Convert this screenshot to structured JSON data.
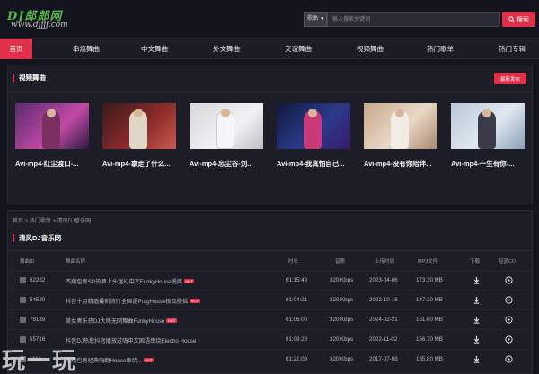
{
  "header": {
    "logo_title": "DJ郎郎网",
    "logo_sub": "www.djjjj.com",
    "search_type": "歌曲",
    "search_placeholder": "输入搜索关键词",
    "search_button": "搜索"
  },
  "nav": {
    "items": [
      "首页",
      "串烧舞曲",
      "中文舞曲",
      "外文舞曲",
      "交谊舞曲",
      "视频舞曲",
      "热门歌单",
      "热门专辑"
    ],
    "active_index": 0
  },
  "video_section": {
    "title": "视频舞曲",
    "latest_button": "最新发布",
    "videos": [
      {
        "label": "Avi-mp4-红尘渡口-..."
      },
      {
        "label": "Avi-mp4-拿走了什么..."
      },
      {
        "label": "Avi-mp4-忘尘谷-刘..."
      },
      {
        "label": "Avi-mp4-我真怕自己..."
      },
      {
        "label": "Avi-mp4-没有你陪伴..."
      },
      {
        "label": "Avi-mp4-一生有你-..."
      }
    ]
  },
  "list_section": {
    "breadcrumb": "首页 > 热门歌单 > 清风DJ音乐网",
    "title": "清风DJ音乐网",
    "columns": [
      "舞曲ID",
      "舞曲名称",
      "时长",
      "音质",
      "上传时间",
      "MP3文件",
      "下载",
      "起源CD"
    ],
    "hot_badge": "HOT",
    "rows": [
      {
        "id": "62282",
        "name": "杰翔包房SD热舞上头迷幻中文FunkyHouse慢摇",
        "duration": "01:15:49",
        "quality": "320 Kbps",
        "date": "2023-04-06",
        "size": "173.30 MB",
        "hot": true
      },
      {
        "id": "54530",
        "name": "抖音十月精选最新流行全国语ProgHouse极品慢摇",
        "duration": "01:04:21",
        "quality": "320 Kbps",
        "date": "2022-10-16",
        "size": "147.20 MB",
        "hot": true
      },
      {
        "id": "78139",
        "name": "美女奏乐热DJ大嗨无网舞曲FunkyHouse",
        "duration": "01:06:00",
        "quality": "320 Kbps",
        "date": "2024-02-21",
        "size": "151.60 MB",
        "hot": true
      },
      {
        "id": "55716",
        "name": "抖音DJ热歌抖音播放过嗨中文国语串烧Electro House",
        "duration": "01:08:29",
        "quality": "320 Kbps",
        "date": "2022-11-02",
        "size": "156.70 MB",
        "hot": false
      },
      {
        "id": "1112",
        "name": "杰翔包房经典嗨翻House串烧...",
        "duration": "01:21:09",
        "quality": "320 Kbps",
        "date": "2017-07-08",
        "size": "185.80 MB",
        "hot": true
      }
    ]
  },
  "watermark": "玩一玩",
  "colors": {
    "accent": "#e0304a",
    "logo": "#56b64a",
    "background": "#14141e"
  }
}
